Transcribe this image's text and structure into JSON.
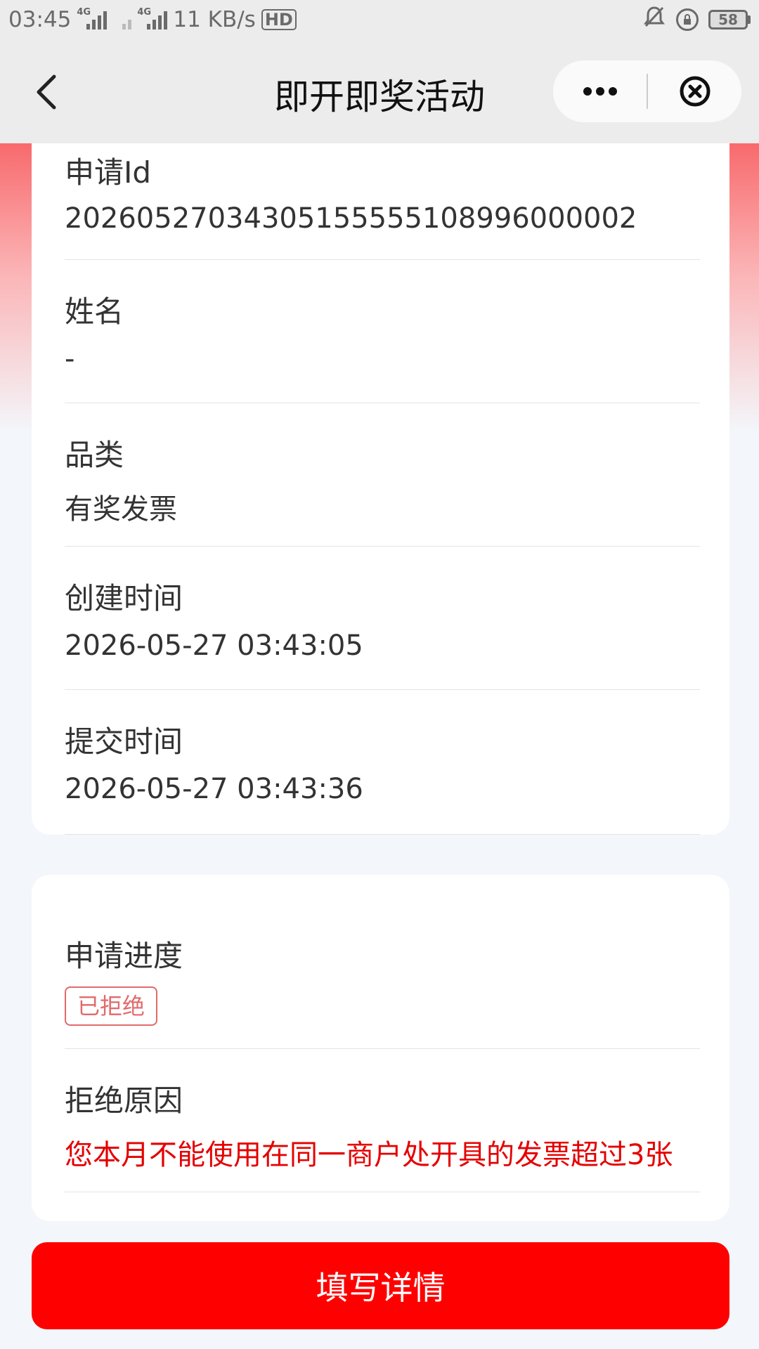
{
  "status_bar": {
    "time": "03:45",
    "network_tag_1": "4G",
    "network_tag_2": "4G",
    "speed": "11 KB/s",
    "hd": "HD",
    "battery": "58"
  },
  "nav": {
    "title": "即开即奖活动"
  },
  "info_fields": [
    {
      "label": "申请Id",
      "value": "20260527034305155555108996000002"
    },
    {
      "label": "姓名",
      "value": "-"
    },
    {
      "label": "品类",
      "value": "有奖发票"
    },
    {
      "label": "创建时间",
      "value": "2026-05-27 03:43:05"
    },
    {
      "label": "提交时间",
      "value": "2026-05-27 03:43:36"
    }
  ],
  "progress": {
    "label": "申请进度",
    "status": "已拒绝",
    "status_color": "#e26a6a"
  },
  "reject": {
    "label": "拒绝原因",
    "reason": "您本月不能使用在同一商户处开具的发票超过3张",
    "reason_color": "#e50000"
  },
  "submit_label": "填写详情",
  "colors": {
    "primary": "#ff0000",
    "gradient_top": "#f86a6d",
    "background": "#f3f6fa"
  }
}
